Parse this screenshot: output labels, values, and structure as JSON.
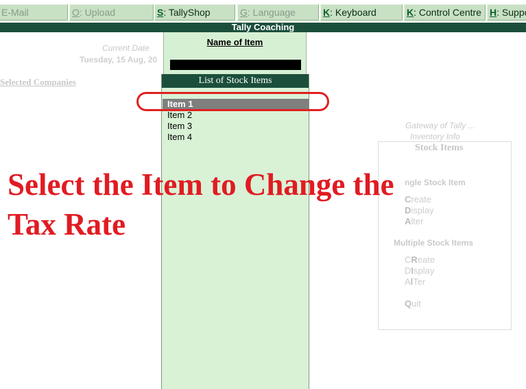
{
  "toolbar": {
    "buttons": [
      {
        "key": "",
        "label": "E-Mail",
        "state": "dim"
      },
      {
        "key": "O",
        "label": ": Upload",
        "state": "dim"
      },
      {
        "key": "S",
        "label": ": TallyShop",
        "state": "active"
      },
      {
        "key": "G",
        "label": ": Language",
        "state": "dim"
      },
      {
        "key": "K",
        "label": ": Keyboard",
        "state": "active"
      },
      {
        "key": "K",
        "label": ": Control Centre",
        "state": "active"
      },
      {
        "key": "H",
        "label": ": Suppo",
        "state": "active"
      }
    ]
  },
  "title_bar": {
    "company": "Tally Coaching"
  },
  "background": {
    "current_date_label": "Current Date",
    "current_date_value": "Tuesday, 15 Aug, 20",
    "selected_companies": "Selected Companies",
    "gateway_title": "Gateway of Tally ...",
    "inventory_info": "Inventory Info",
    "stock_items_title": "Stock Items",
    "single_stock_header": "ngle Stock Item",
    "single_options": [
      {
        "key": "C",
        "rest": "reate"
      },
      {
        "key": "D",
        "rest": "isplay"
      },
      {
        "key": "A",
        "rest": "lter"
      }
    ],
    "multiple_stock_header": "Multiple Stock Items",
    "multiple_options": [
      {
        "pre": "C",
        "key": "R",
        "rest": "eate"
      },
      {
        "pre": "D",
        "key": "I",
        "rest": "splay"
      },
      {
        "pre": "A",
        "key": "l",
        "rest": "Ter"
      }
    ],
    "quit": {
      "key": "Q",
      "rest": "uit"
    }
  },
  "name_panel": {
    "label": "Name of Item",
    "input_value": ""
  },
  "stock_list": {
    "header": "List of Stock Items",
    "items": [
      "Item 1",
      "Item 2",
      "Item 3",
      "Item 4"
    ],
    "selected_index": 0
  },
  "annotation": {
    "line1": "Select the Item to Change the",
    "line2": "Tax Rate"
  },
  "colors": {
    "accent_dark_green": "#1b4f3c",
    "panel_green": "#d9f2d6",
    "selection_gray": "#7f7f7f",
    "annotation_red": "#e11b22"
  }
}
